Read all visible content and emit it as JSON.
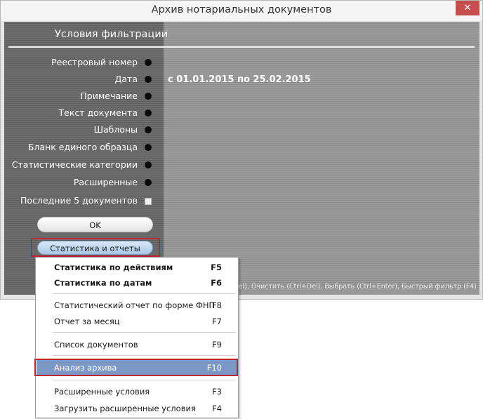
{
  "window": {
    "title": "Архив нотариальных документов",
    "close_glyph": "✕"
  },
  "filter": {
    "heading": "Условия фильтрации",
    "rows": [
      {
        "label": "Реестровый номер",
        "indicator": "dot"
      },
      {
        "label": "Дата",
        "indicator": "dot",
        "value": "с 01.01.2015 по 25.02.2015"
      },
      {
        "label": "Примечание",
        "indicator": "dot"
      },
      {
        "label": "Текст документа",
        "indicator": "dot"
      },
      {
        "label": "Шаблоны",
        "indicator": "dot"
      },
      {
        "label": "Бланк единого образца",
        "indicator": "dot"
      },
      {
        "label": "Статистические категории",
        "indicator": "dot"
      },
      {
        "label": "Расширенные",
        "indicator": "dot"
      },
      {
        "label": "Последние 5 документов",
        "indicator": "checkbox",
        "checked": false
      }
    ],
    "ok_button": "OK",
    "stats_button": "Статистика и отчеты",
    "hint": "...лить (Del), Очистить (Ctrl+Del), Выбрать (Ctrl+Enter), Быстрый фильтр (F4)"
  },
  "menu": {
    "items": [
      {
        "label": "Статистика по действиям",
        "key": "F5",
        "bold": true
      },
      {
        "label": "Статистика по датам",
        "key": "F6",
        "bold": true
      },
      {
        "label": "Статистический отчет по форме ФНП",
        "key": "F8"
      },
      {
        "label": "Отчет за месяц",
        "key": "F7"
      },
      {
        "label": "Список документов",
        "key": "F9"
      },
      {
        "label": "Анализ архива",
        "key": "F10",
        "selected": true
      },
      {
        "label": "Расширенные условия",
        "key": "F3"
      },
      {
        "label": "Загрузить расширенные условия",
        "key": "F4"
      }
    ]
  },
  "colors": {
    "highlight_frame": "#c0252e",
    "menu_selected": "#7b99c4"
  }
}
